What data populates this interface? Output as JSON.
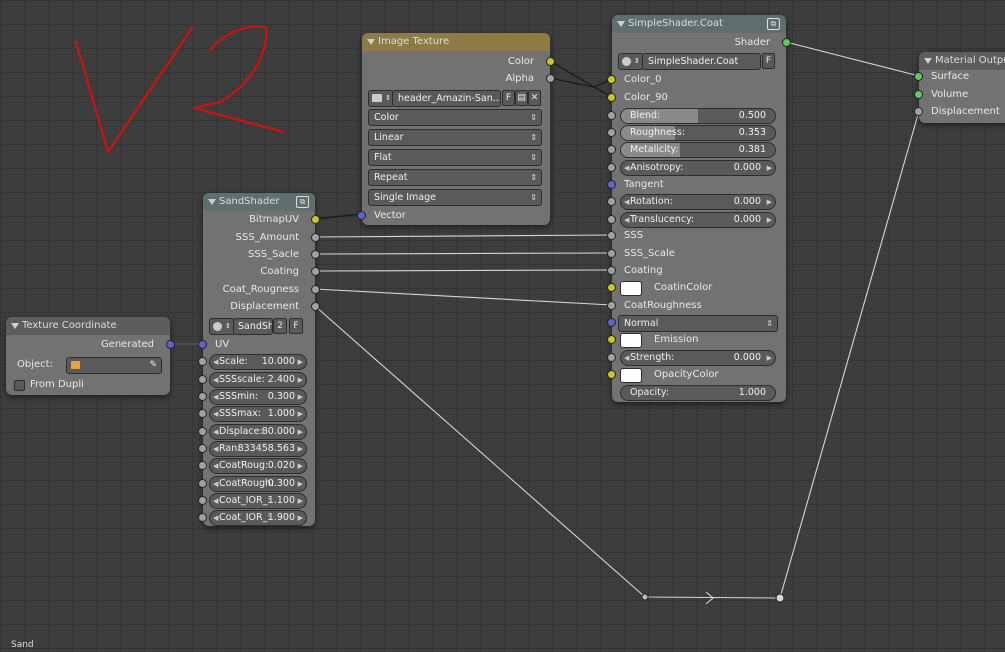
{
  "image_texture": {
    "title": "Image Texture",
    "out_color": "Color",
    "out_alpha": "Alpha",
    "image_name": "header_Amazin-San...",
    "fake_user": "F",
    "color_space": "Color",
    "interpolation": "Linear",
    "projection": "Flat",
    "extension": "Repeat",
    "source": "Single Image",
    "in_vector": "Vector"
  },
  "simple_shader": {
    "title": "SimpleShader.Coat",
    "out_shader": "Shader",
    "group_name": "SimpleShader.Coat",
    "fake_user": "F",
    "color_0": "Color_0",
    "color_90": "Color_90",
    "blend_label": "Blend:",
    "blend_value": "0.500",
    "blend_fraction": 0.5,
    "roughness_label": "Roughness:",
    "roughness_value": "0.353",
    "roughness_fraction": 0.353,
    "metalicity_label": "Metalicity:",
    "metalicity_value": "0.381",
    "metalicity_fraction": 0.381,
    "anisotropy_label": "Anisotropy:",
    "anisotropy_value": "0.000",
    "tangent": "Tangent",
    "rotation_label": "Rotation:",
    "rotation_value": "0.000",
    "translucency_label": "Translucency:",
    "translucency_value": "0.000",
    "sss": "SSS",
    "sss_scale": "SSS_Scale",
    "coating": "Coating",
    "coatin_color": "CoatinColor",
    "coat_roughness": "CoatRoughness",
    "normal": "Normal",
    "emission": "Emission",
    "strength_label": "Strength:",
    "strength_value": "0.000",
    "opacity_color": "OpacityColor",
    "opacity_label": "Opacity:",
    "opacity_value": "1.000"
  },
  "material_output": {
    "title": "Material Output",
    "surface": "Surface",
    "volume": "Volume",
    "displacement": "Displacement"
  },
  "sand_shader": {
    "title": "SandShader",
    "outputs": [
      "BitmapUV",
      "SSS_Amount",
      "SSS_Sacle",
      "Coating",
      "Coat_Rougness",
      "Displacement"
    ],
    "group_name": "SandSh",
    "users": "2",
    "fake_user": "F",
    "uv": "UV",
    "params": [
      {
        "label": "Scale:",
        "value": "10.000"
      },
      {
        "label": "SSSscale:",
        "value": "2.400"
      },
      {
        "label": "SSSmin:",
        "value": "0.300"
      },
      {
        "label": "SSSmax:",
        "value": "1.000"
      },
      {
        "label": "Displace:",
        "value": "80.000"
      },
      {
        "label": "Ran:",
        "value": "833458.563"
      },
      {
        "label": "CoatRoug:",
        "value": "0.020"
      },
      {
        "label": "CoatRough:",
        "value": "0.300"
      },
      {
        "label": "Coat_IOR_:",
        "value": "1.100"
      },
      {
        "label": "Coat_IOR_:",
        "value": "1.900"
      }
    ]
  },
  "texture_coordinate": {
    "title": "Texture Coordinate",
    "out_generated": "Generated",
    "object_label": "Object:",
    "from_dupli": "From Dupli"
  },
  "status": "Sand",
  "colors": {
    "socket_color": "#c7c729",
    "socket_float": "#a1a1a1",
    "socket_vector": "#6363c7",
    "socket_shader": "#63c763",
    "annotation": "#d01818"
  }
}
